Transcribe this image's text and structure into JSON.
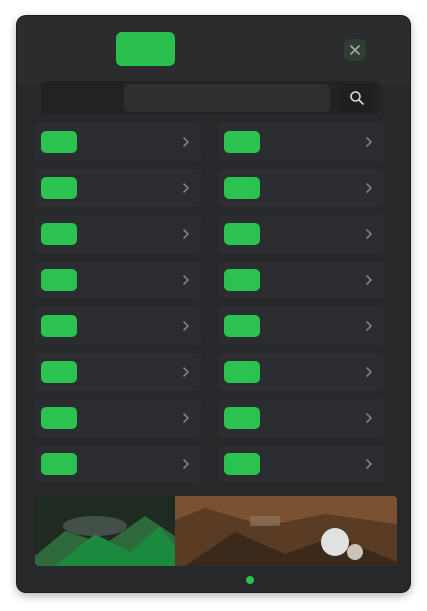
{
  "header": {
    "title": "",
    "active_tab": "",
    "links": "",
    "close_icon": "close-icon"
  },
  "search": {
    "label": "",
    "placeholder": "",
    "value": "",
    "button_icon": "search-icon"
  },
  "items": [
    {
      "badge": "",
      "label": ""
    },
    {
      "badge": "",
      "label": ""
    },
    {
      "badge": "",
      "label": ""
    },
    {
      "badge": "",
      "label": ""
    },
    {
      "badge": "",
      "label": ""
    },
    {
      "badge": "",
      "label": ""
    },
    {
      "badge": "",
      "label": ""
    },
    {
      "badge": "",
      "label": ""
    },
    {
      "badge": "",
      "label": ""
    },
    {
      "badge": "",
      "label": ""
    },
    {
      "badge": "",
      "label": ""
    },
    {
      "badge": "",
      "label": ""
    },
    {
      "badge": "",
      "label": ""
    },
    {
      "badge": "",
      "label": ""
    },
    {
      "badge": "",
      "label": ""
    },
    {
      "badge": "",
      "label": ""
    }
  ],
  "colors": {
    "accent": "#2bc24f",
    "background": "#26282a",
    "panel": "#2b2d30"
  }
}
